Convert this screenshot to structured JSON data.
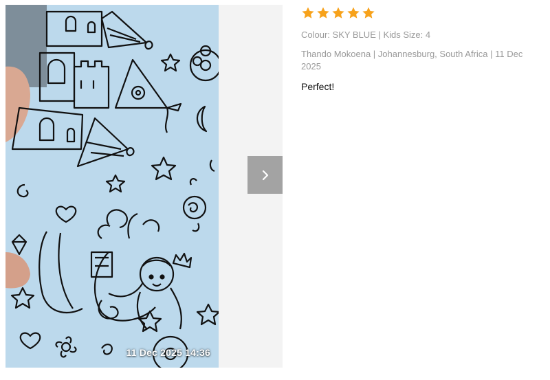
{
  "gallery": {
    "timestamp": "11 Dec 2025 14:36",
    "next_icon": "chevron-right-icon"
  },
  "review": {
    "rating": 5,
    "rating_max": 5,
    "star_color": "#f7a21b",
    "star_icon": "star-icon",
    "variant": "Colour: SKY BLUE | Kids Size: 4",
    "author_line": "Thando Mokoena | Johannesburg, South Africa | 11 Dec 2025",
    "text": "Perfect!"
  }
}
